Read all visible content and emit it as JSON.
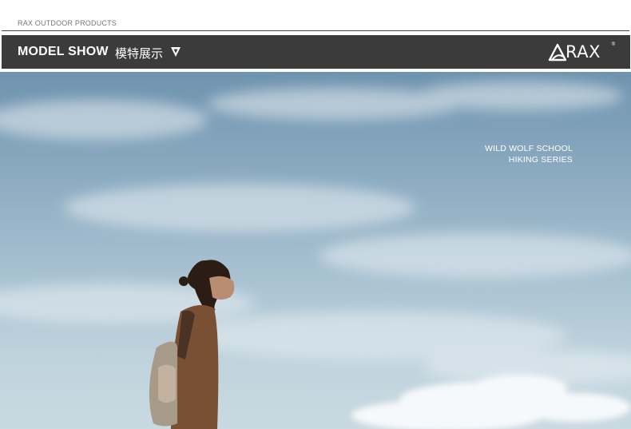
{
  "top_bar": {
    "label": "RAX OUTDOOR PRODUCTS"
  },
  "header": {
    "title": "MODEL SHOW",
    "subtitle": "模特展示",
    "down_icon": "triangle-down-icon",
    "brand_logo_text": "RAX",
    "brand_reg_mark": "®"
  },
  "hero": {
    "series_line1": "WILD WOLF SCHOOL",
    "series_line2": "HIKING SERIES"
  },
  "colors": {
    "header_bg": "#3b3b3b",
    "sky_top": "#6f93ae",
    "sky_bottom": "#c9d9e0",
    "jacket": "#7a5035"
  }
}
